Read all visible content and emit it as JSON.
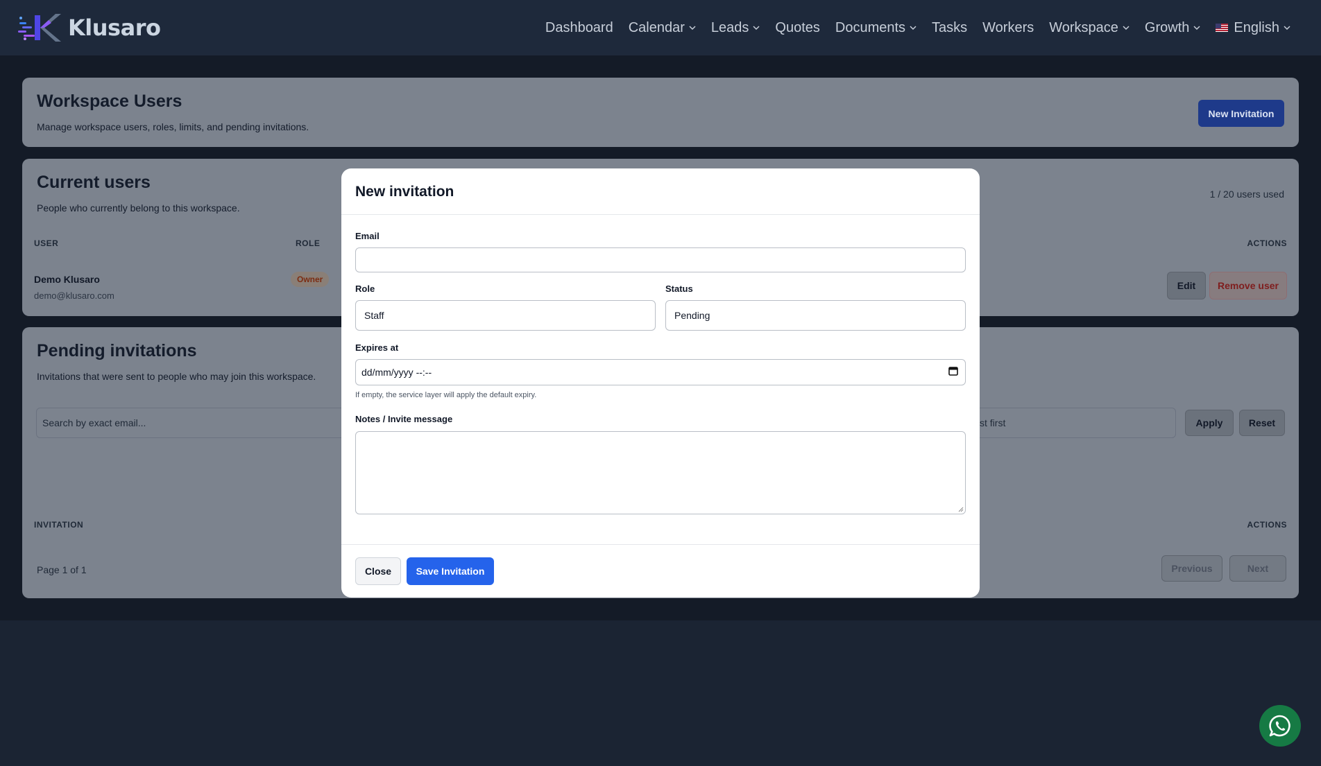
{
  "brand": {
    "name": "Klusaro"
  },
  "nav": {
    "items": [
      {
        "label": "Dashboard",
        "dropdown": false
      },
      {
        "label": "Calendar",
        "dropdown": true
      },
      {
        "label": "Leads",
        "dropdown": true
      },
      {
        "label": "Quotes",
        "dropdown": false
      },
      {
        "label": "Documents",
        "dropdown": true
      },
      {
        "label": "Tasks",
        "dropdown": false
      },
      {
        "label": "Workers",
        "dropdown": false
      },
      {
        "label": "Workspace",
        "dropdown": true
      },
      {
        "label": "Growth",
        "dropdown": true
      }
    ],
    "language": "English"
  },
  "header_card": {
    "title": "Workspace Users",
    "subtitle": "Manage workspace users, roles, limits, and pending invitations.",
    "new_invitation_label": "New Invitation"
  },
  "current_users": {
    "title": "Current users",
    "subtitle": "People who currently belong to this workspace.",
    "usage": "1 / 20 users used",
    "columns": {
      "user": "USER",
      "role": "ROLE",
      "actions": "ACTIONS"
    },
    "rows": [
      {
        "name": "Demo Klusaro",
        "email": "demo@klusaro.com",
        "role": "Owner",
        "edit_label": "Edit",
        "remove_label": "Remove user"
      }
    ]
  },
  "pending": {
    "title": "Pending invitations",
    "subtitle": "Invitations that were sent to people who may join this workspace.",
    "search_placeholder": "Search by exact email...",
    "sort_value": "st first",
    "apply_label": "Apply",
    "reset_label": "Reset",
    "columns": {
      "invitation": "INVITATION",
      "actions": "ACTIONS"
    },
    "page_info": "Page 1 of 1",
    "previous_label": "Previous",
    "next_label": "Next"
  },
  "modal": {
    "title": "New invitation",
    "email_label": "Email",
    "email_value": "",
    "role_label": "Role",
    "role_value": "Staff",
    "status_label": "Status",
    "status_value": "Pending",
    "expires_label": "Expires at",
    "expires_placeholder": "dd/mm/yyyy --:--",
    "expires_hint": "If empty, the service layer will apply the default expiry.",
    "notes_label": "Notes / Invite message",
    "notes_value": "",
    "close_label": "Close",
    "save_label": "Save Invitation"
  },
  "colors": {
    "primary": "#2563eb",
    "navbar": "#1e293b",
    "whatsapp": "#167a44"
  }
}
